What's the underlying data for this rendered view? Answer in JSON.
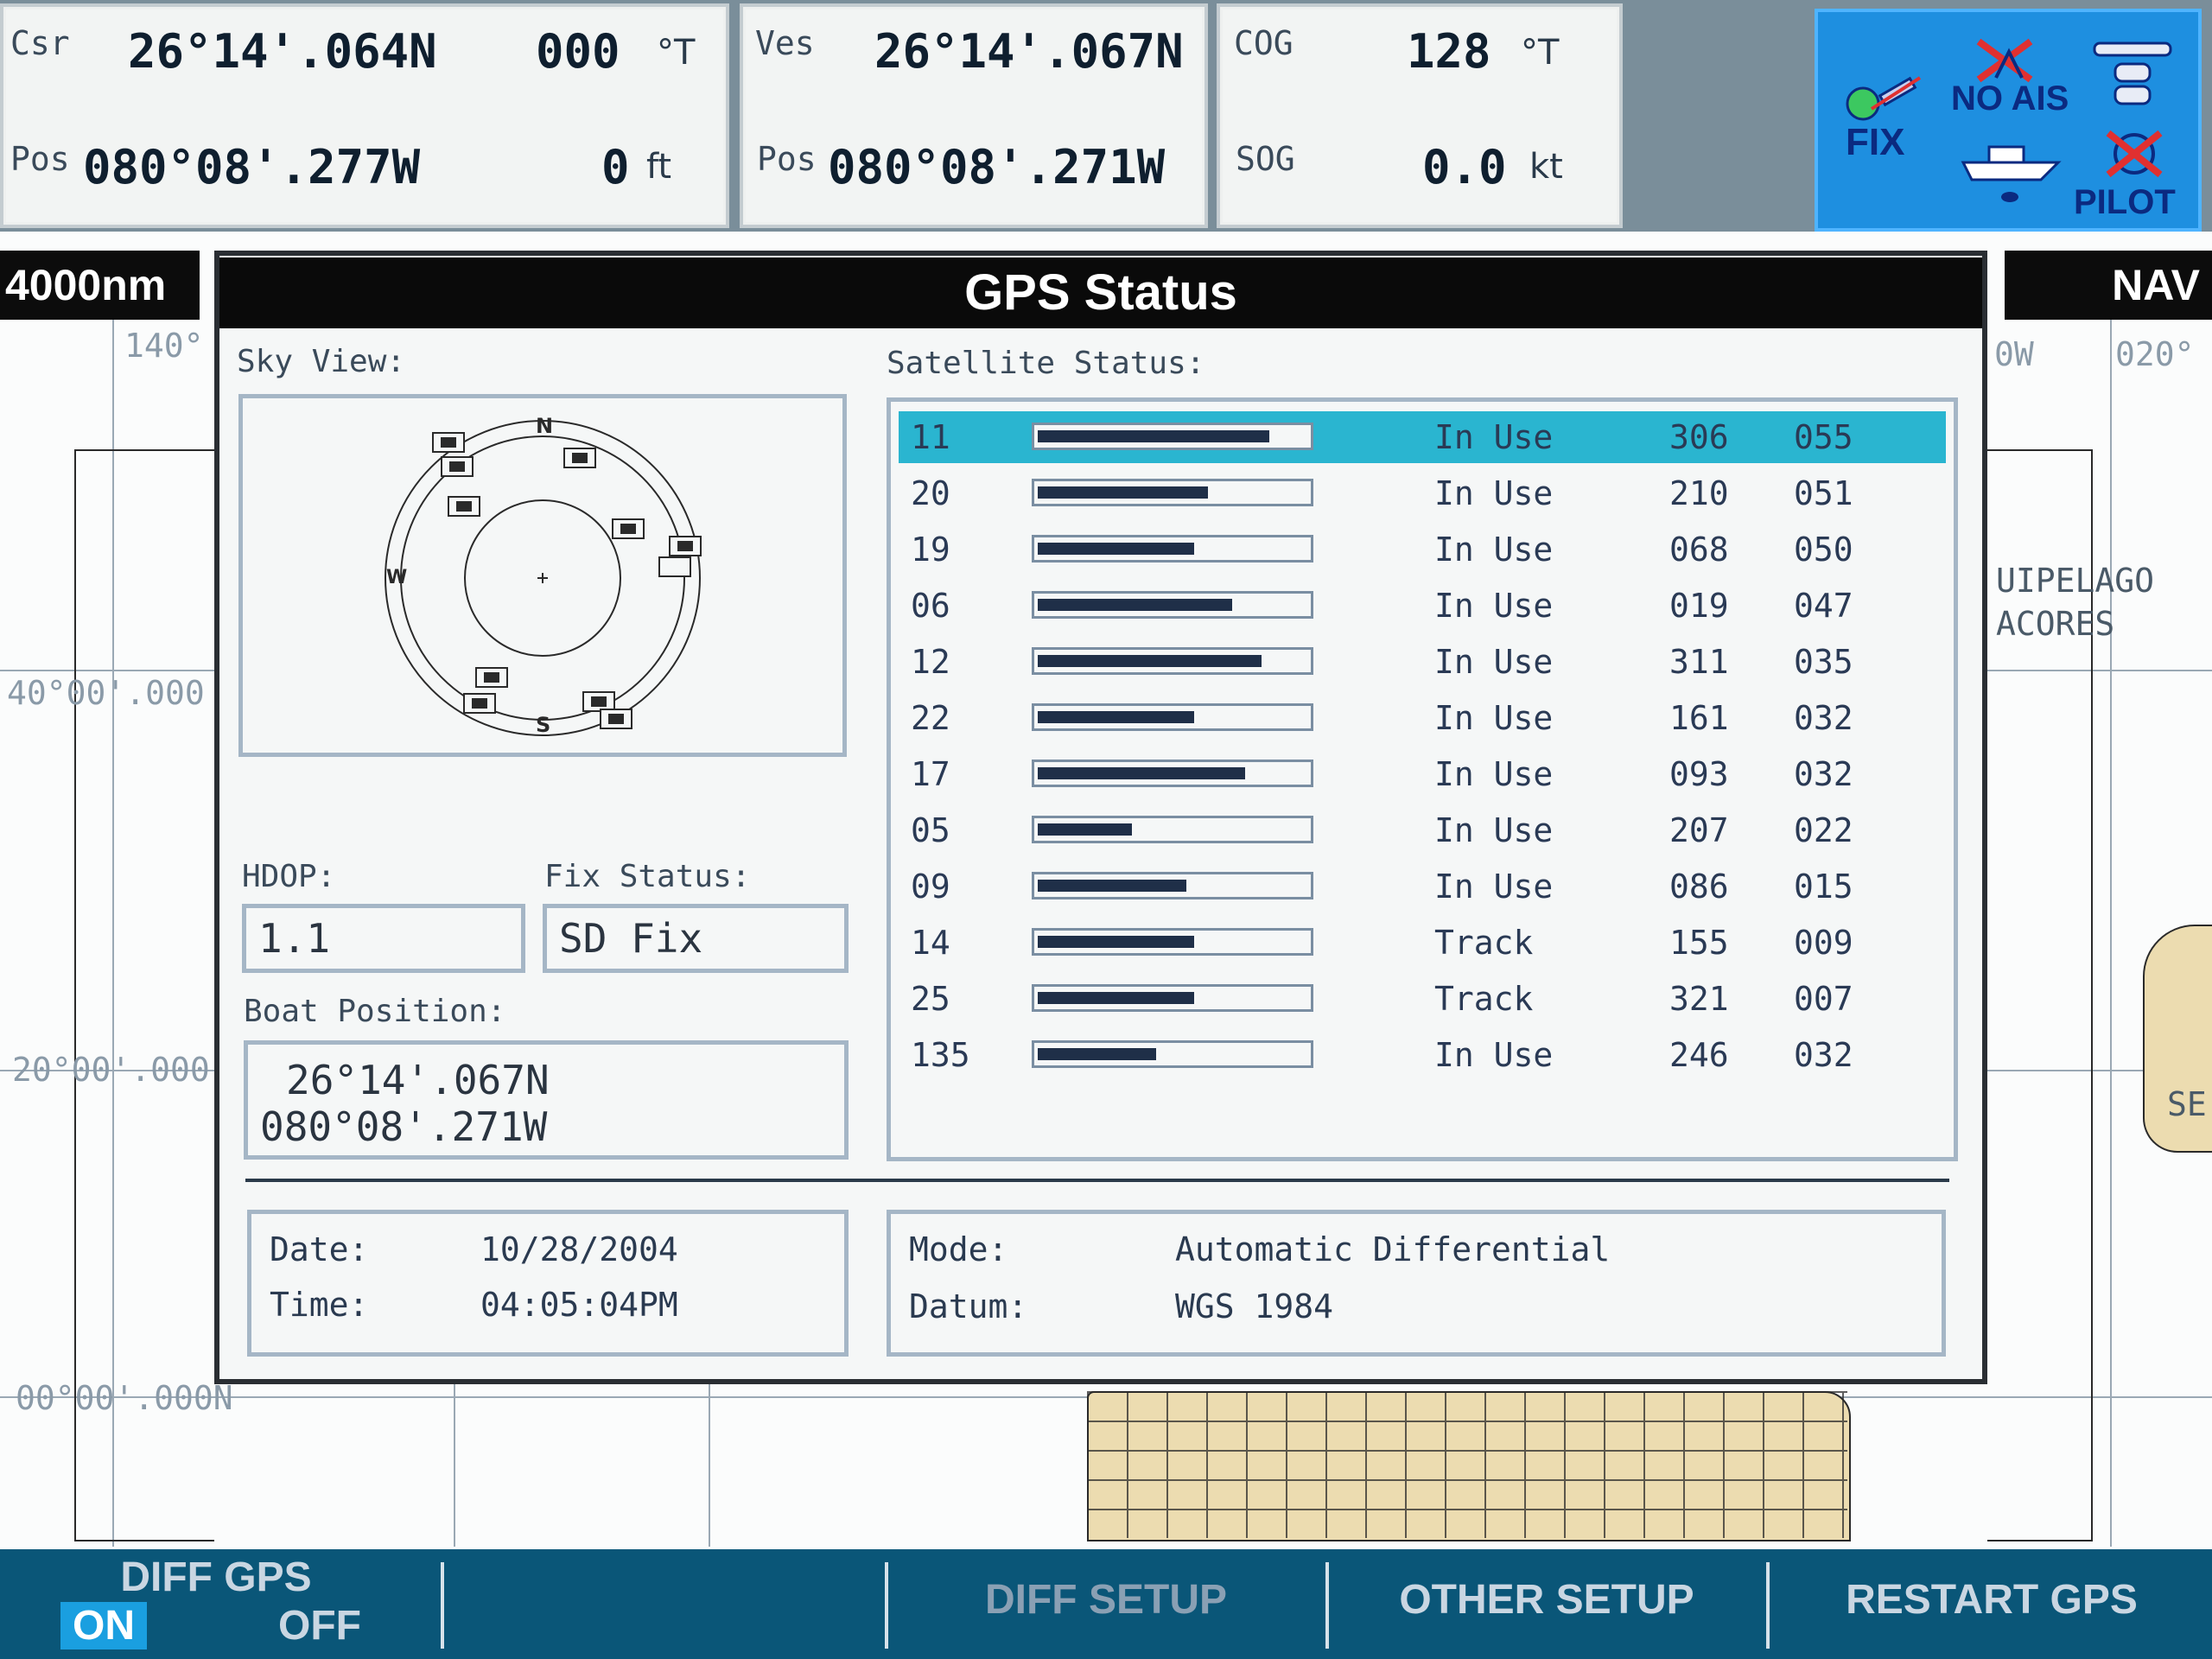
{
  "top_bar": {
    "csr": {
      "label": "Csr",
      "lat": "26°14'.064N",
      "pos_label": "Pos",
      "lon": "080°08'.277W",
      "heading": "000",
      "heading_unit": "°T",
      "depth": "0",
      "depth_unit": "ft"
    },
    "ves": {
      "label": "Ves",
      "lat": "26°14'.067N",
      "pos_label": "Pos",
      "lon": "080°08'.271W"
    },
    "cog": {
      "label": "COG",
      "value": "128",
      "unit": "°T"
    },
    "sog": {
      "label": "SOG",
      "value": "0.0",
      "unit": "kt"
    },
    "status_icons": {
      "fix": "FIX",
      "noais": "NO AIS",
      "pilot": "PILOT"
    }
  },
  "chart": {
    "scale": "4000nm",
    "mode": "NAV",
    "grid_labels": [
      "140°",
      "40°00'.000",
      "20°00'.000",
      "00°00'.000N",
      "0W",
      "020°",
      "UIPELAGO",
      "ACORES",
      "SE"
    ]
  },
  "dialog": {
    "title": "GPS Status",
    "sky_view_label": "Sky View:",
    "sky_compass": {
      "n": "N",
      "s": "S",
      "w": "W"
    },
    "satellite_status_label": "Satellite Status:",
    "hdop_label": "HDOP:",
    "hdop_value": "1.1",
    "fix_status_label": "Fix Status:",
    "fix_status_value": "SD Fix",
    "boat_position_label": "Boat Position:",
    "boat_lat": "26°14'.067N",
    "boat_lon": "080°08'.271W",
    "date_label": "Date:",
    "date_value": "10/28/2004",
    "time_label": "Time:",
    "time_value": "04:05:04PM",
    "mode_label": "Mode:",
    "mode_value": "Automatic Differential",
    "datum_label": "Datum:",
    "datum_value": "WGS 1984",
    "satellites": [
      {
        "id": "11",
        "signal": 0.86,
        "status": "In Use",
        "az": "306",
        "el": "055",
        "selected": true
      },
      {
        "id": "20",
        "signal": 0.63,
        "status": "In Use",
        "az": "210",
        "el": "051"
      },
      {
        "id": "19",
        "signal": 0.58,
        "status": "In Use",
        "az": "068",
        "el": "050"
      },
      {
        "id": "06",
        "signal": 0.72,
        "status": "In Use",
        "az": "019",
        "el": "047"
      },
      {
        "id": "12",
        "signal": 0.83,
        "status": "In Use",
        "az": "311",
        "el": "035"
      },
      {
        "id": "22",
        "signal": 0.58,
        "status": "In Use",
        "az": "161",
        "el": "032"
      },
      {
        "id": "17",
        "signal": 0.77,
        "status": "In Use",
        "az": "093",
        "el": "032"
      },
      {
        "id": "05",
        "signal": 0.35,
        "status": "In Use",
        "az": "207",
        "el": "022"
      },
      {
        "id": "09",
        "signal": 0.55,
        "status": "In Use",
        "az": "086",
        "el": "015"
      },
      {
        "id": "14",
        "signal": 0.58,
        "status": "Track",
        "az": "155",
        "el": "009"
      },
      {
        "id": "25",
        "signal": 0.58,
        "status": "Track",
        "az": "321",
        "el": "007"
      },
      {
        "id": "135",
        "signal": 0.44,
        "status": "In Use",
        "az": "246",
        "el": "032"
      }
    ]
  },
  "softkeys": {
    "diff_gps": "DIFF GPS",
    "on": "ON",
    "off": "OFF",
    "diff_setup": "DIFF SETUP",
    "other_setup": "OTHER SETUP",
    "restart_gps": "RESTART GPS"
  }
}
